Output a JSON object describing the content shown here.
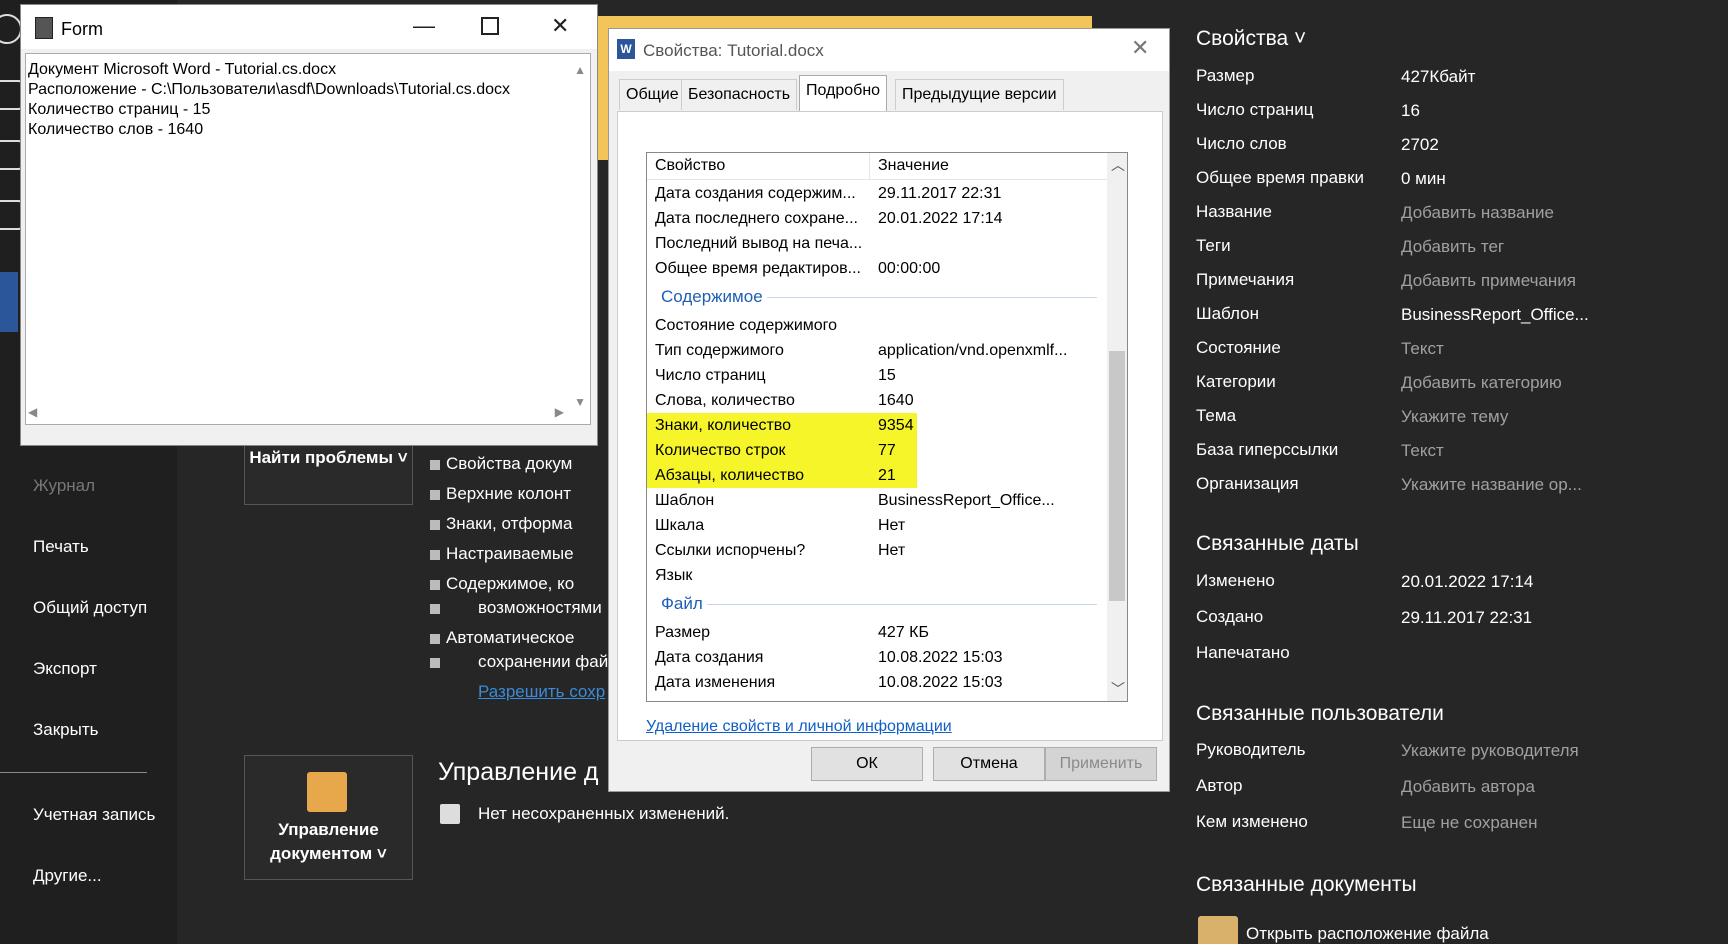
{
  "backstage_nav": {
    "items": [
      {
        "label": "Журнал",
        "dim": true
      },
      {
        "label": "Печать"
      },
      {
        "label": "Общий доступ"
      },
      {
        "label": "Экспорт"
      },
      {
        "label": "Закрыть"
      },
      {
        "label": "Учетная запись"
      },
      {
        "label": "Другие..."
      }
    ]
  },
  "middle": {
    "check_button": "Найти проблемы ˅",
    "manage_button": "Управление документом ˅",
    "bullets": [
      "Свойства докум",
      "Верхние колонт",
      "Знаки, отформа",
      "Настраиваемые",
      "Содержимое, ко",
      "возможностями",
      "Автоматическое",
      "сохранении фай"
    ],
    "allow_link": "Разрешить сохр",
    "manage_title": "Управление д",
    "no_unsaved": "Нет несохраненных изменений."
  },
  "right_panel": {
    "properties_heading": "Свойства ˅",
    "properties": [
      {
        "label": "Размер",
        "value": "427Кбайт"
      },
      {
        "label": "Число страниц",
        "value": "16"
      },
      {
        "label": "Число слов",
        "value": "2702"
      },
      {
        "label": "Общее время правки",
        "value": "0 мин"
      },
      {
        "label": "Название",
        "value": "Добавить название",
        "dim": true
      },
      {
        "label": "Теги",
        "value": "Добавить тег",
        "dim": true
      },
      {
        "label": "Примечания",
        "value": "Добавить примечания",
        "dim": true
      },
      {
        "label": "Шаблон",
        "value": "BusinessReport_Office..."
      },
      {
        "label": "Состояние",
        "value": "Текст",
        "dim": true
      },
      {
        "label": "Категории",
        "value": "Добавить категорию",
        "dim": true
      },
      {
        "label": "Тема",
        "value": "Укажите тему",
        "dim": true
      },
      {
        "label": "База гиперссылки",
        "value": "Текст",
        "dim": true
      },
      {
        "label": "Организация",
        "value": "Укажите название ор...",
        "dim": true
      }
    ],
    "dates_heading": "Связанные даты",
    "dates": [
      {
        "label": "Изменено",
        "value": "20.01.2022 17:14"
      },
      {
        "label": "Создано",
        "value": "29.11.2017 22:31"
      },
      {
        "label": "Напечатано",
        "value": ""
      }
    ],
    "users_heading": "Связанные пользователи",
    "users": [
      {
        "label": "Руководитель",
        "value": "Укажите руководителя"
      },
      {
        "label": "Автор",
        "value": "Добавить автора"
      },
      {
        "label": "Кем изменено",
        "value": "Еще не сохранен"
      }
    ],
    "docs_heading": "Связанные документы",
    "open_location": "Открыть расположение файла"
  },
  "form_window": {
    "title": "Form",
    "lines": [
      "Документ Microsoft Word - Tutorial.cs.docx",
      "Расположение - C:\\Пользователи\\asdf\\Downloads\\Tutorial.cs.docx",
      "Количество страниц - 15",
      "Количество слов - 1640"
    ]
  },
  "props_dialog": {
    "title": "Свойства: Tutorial.docx",
    "tabs": [
      "Общие",
      "Безопасность",
      "Подробно",
      "Предыдущие версии"
    ],
    "active_tab": "Подробно",
    "col_property": "Свойство",
    "col_value": "Значение",
    "rows_top": [
      {
        "name": "Дата создания содержим...",
        "value": "29.11.2017 22:31"
      },
      {
        "name": "Дата последнего сохране...",
        "value": "20.01.2022 17:14"
      },
      {
        "name": "Последний вывод на печа...",
        "value": ""
      },
      {
        "name": "Общее время редактиров...",
        "value": "00:00:00"
      }
    ],
    "group_content": "Содержимое",
    "rows_content": [
      {
        "name": "Состояние содержимого",
        "value": ""
      },
      {
        "name": "Тип содержимого",
        "value": "application/vnd.openxmlf..."
      },
      {
        "name": "Число страниц",
        "value": "15"
      },
      {
        "name": "Слова, количество",
        "value": "1640"
      },
      {
        "name": "Знаки, количество",
        "value": "9354"
      },
      {
        "name": "Количество строк",
        "value": "77"
      },
      {
        "name": "Абзацы, количество",
        "value": "21"
      },
      {
        "name": "Шаблон",
        "value": "BusinessReport_Office..."
      },
      {
        "name": "Шкала",
        "value": "Нет"
      },
      {
        "name": "Ссылки испорчены?",
        "value": "Нет"
      },
      {
        "name": "Язык",
        "value": ""
      }
    ],
    "group_file": "Файл",
    "rows_file": [
      {
        "name": "Размер",
        "value": "427 КБ"
      },
      {
        "name": "Дата создания",
        "value": "10.08.2022 15:03"
      },
      {
        "name": "Дата изменения",
        "value": "10.08.2022 15:03"
      }
    ],
    "remove_link": "Удаление свойств и личной информации",
    "ok": "ОК",
    "cancel": "Отмена",
    "apply": "Применить",
    "highlight_color": "#f5f52a"
  }
}
